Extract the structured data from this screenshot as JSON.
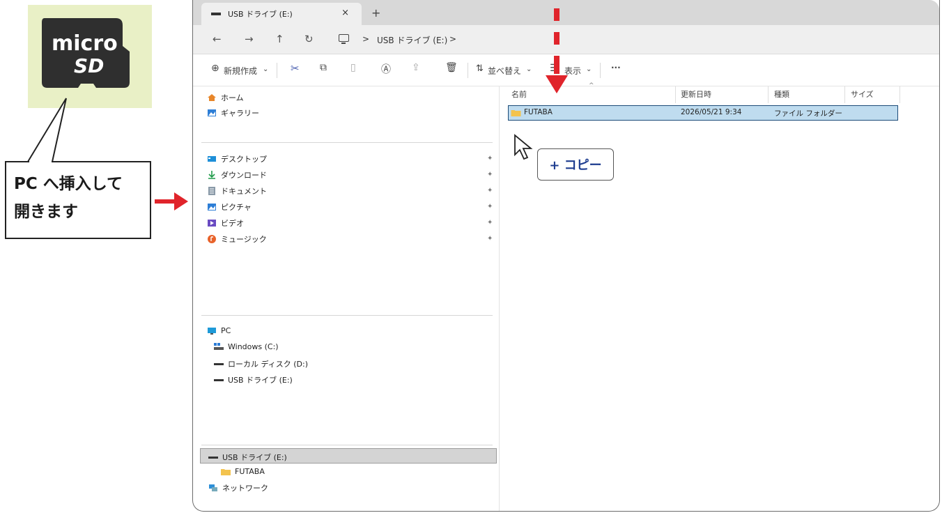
{
  "callout": {
    "line1": "PC へ挿入して",
    "line2": "開きます"
  },
  "tab": {
    "title": "USB ドライブ (E:)",
    "close": "×",
    "new": "+"
  },
  "nav_buttons": {
    "back": "←",
    "forward": "→",
    "up": "↑",
    "refresh": "↻"
  },
  "address": {
    "sep1": ">",
    "segment": "USB ドライブ (E:)",
    "sep2": ">"
  },
  "toolbar": {
    "new": "新規作成",
    "sort": "並べ替え",
    "view": "表示",
    "more": "···",
    "chevron": "⌄"
  },
  "nav": {
    "home": "ホーム",
    "gallery": "ギャラリー",
    "quick": [
      "デスクトップ",
      "ダウンロード",
      "ドキュメント",
      "ピクチャ",
      "ビデオ",
      "ミュージック"
    ],
    "pc": "PC",
    "drives": [
      "Windows (C:)",
      "ローカル ディスク (D:)",
      "USB ドライブ (E:)"
    ],
    "selected": "USB ドライブ (E:)",
    "folder": "FUTABA",
    "network": "ネットワーク",
    "pin_glyph": "📌"
  },
  "columns": {
    "name": "名前",
    "date": "更新日時",
    "type": "種類",
    "size": "サイズ"
  },
  "rows": [
    {
      "name": "FUTABA",
      "date": "2026/05/21 9:34",
      "type": "ファイル フォルダー"
    }
  ],
  "copy_badge": "+ コピー",
  "colors": {
    "accent_red": "#e0242b",
    "selection": "#bfdcef",
    "folder": "#f3c34e",
    "badge_text": "#1d3c8f"
  }
}
